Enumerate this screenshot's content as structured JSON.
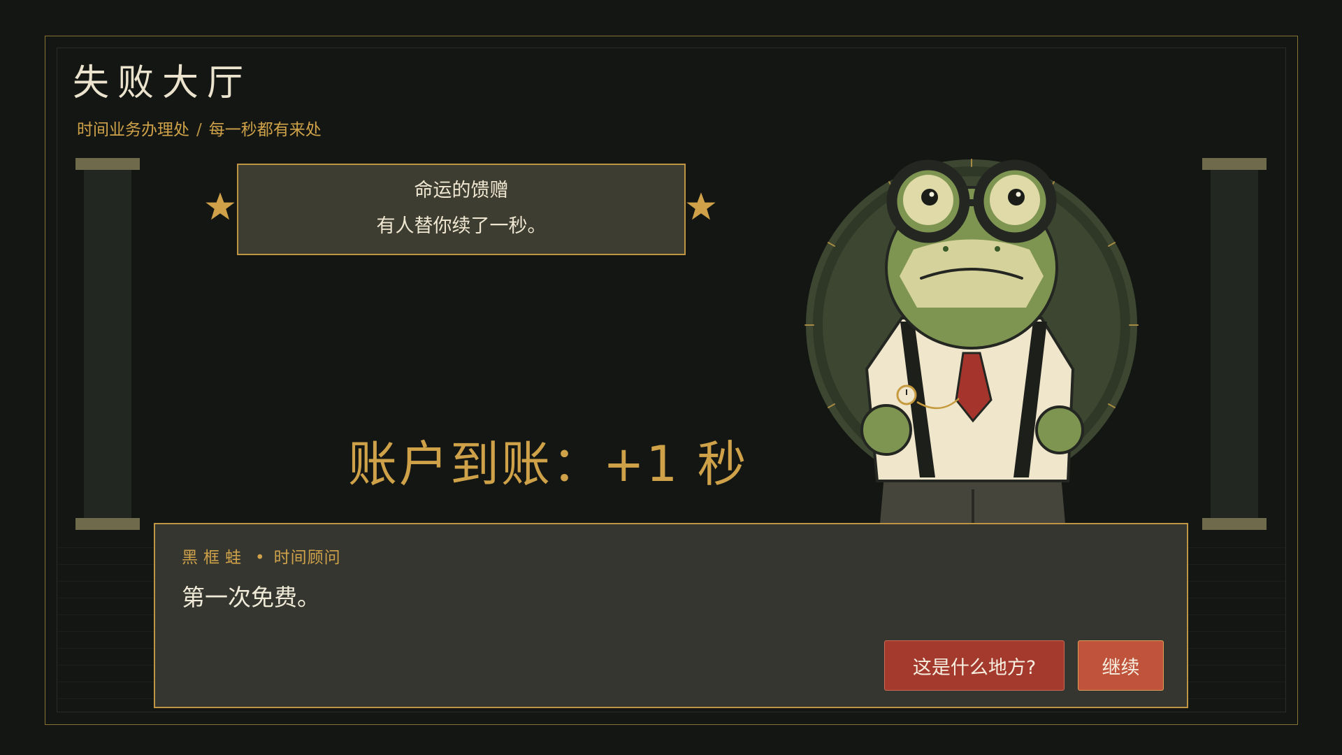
{
  "header": {
    "title": "失败大厅",
    "breadcrumb": [
      "时间业务办理处",
      "每一秒都有来处"
    ],
    "breadcrumb_separator": "/"
  },
  "gift": {
    "title": "命运的馈赠",
    "text": "有人替你续了一秒。",
    "star_icon": "star-icon"
  },
  "credit": {
    "text": "账户到账：+1 秒"
  },
  "character": {
    "icon": "frog-advisor-portrait"
  },
  "dialog": {
    "speaker_name": "黑框蛙",
    "speaker_separator": "•",
    "speaker_role": "时间顾问",
    "line": "第一次免费。",
    "buttons": {
      "ask": "这是什么地方?",
      "continue": "继续"
    }
  },
  "colors": {
    "background": "#141614",
    "gold": "#cfa24a",
    "panel": "#363630",
    "button_red": "#a43a2e",
    "button_orange": "#c0533b",
    "text_light": "#f0ead8"
  }
}
